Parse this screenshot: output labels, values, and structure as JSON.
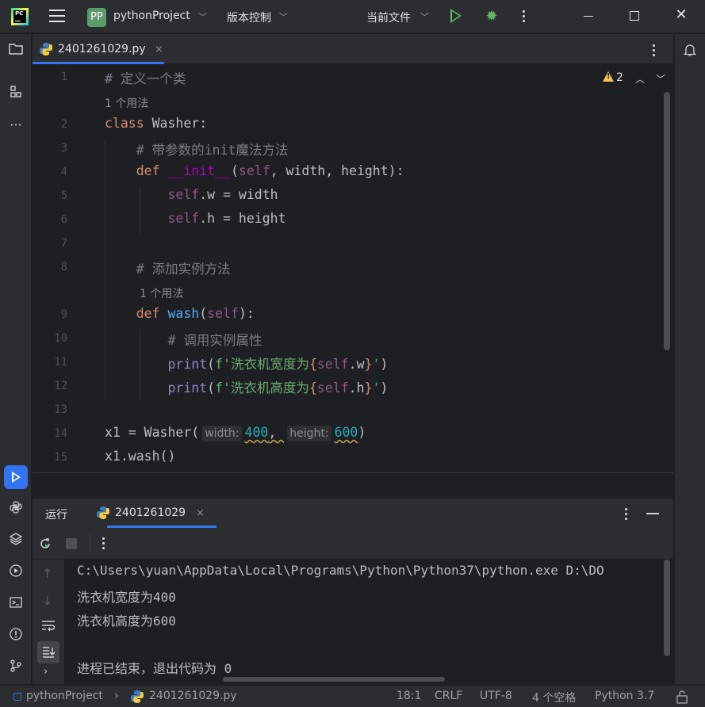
{
  "titlebar": {
    "project_badge": "PP",
    "project_name": "pythonProject",
    "vcs_label": "版本控制",
    "run_config": "当前文件"
  },
  "editor": {
    "tab": {
      "filename": "2401261029.py",
      "close": "×"
    },
    "warnings_count": "2",
    "lines": [
      {
        "num": "1",
        "kind": "code",
        "id": "l1"
      },
      {
        "num": "",
        "kind": "usage",
        "text": "1 个用法"
      },
      {
        "num": "2",
        "kind": "code",
        "id": "l2"
      },
      {
        "num": "3",
        "kind": "code",
        "id": "l3"
      },
      {
        "num": "4",
        "kind": "code",
        "id": "l4"
      },
      {
        "num": "5",
        "kind": "code",
        "id": "l5"
      },
      {
        "num": "6",
        "kind": "code",
        "id": "l6"
      },
      {
        "num": "7",
        "kind": "code",
        "id": "l7"
      },
      {
        "num": "8",
        "kind": "code",
        "id": "l8"
      },
      {
        "num": "",
        "kind": "usage",
        "text": "1 个用法"
      },
      {
        "num": "9",
        "kind": "code",
        "id": "l9"
      },
      {
        "num": "10",
        "kind": "code",
        "id": "l10"
      },
      {
        "num": "11",
        "kind": "code",
        "id": "l11"
      },
      {
        "num": "12",
        "kind": "code",
        "id": "l12"
      },
      {
        "num": "13",
        "kind": "code",
        "id": "l13"
      },
      {
        "num": "14",
        "kind": "code",
        "id": "l14"
      },
      {
        "num": "15",
        "kind": "code",
        "id": "l15"
      }
    ],
    "code": {
      "l1": [
        {
          "t": "cmt",
          "v": "# 定义一个类"
        }
      ],
      "l2": [
        {
          "t": "kw",
          "v": "class "
        },
        {
          "t": "plain",
          "v": "Washer:"
        }
      ],
      "l3": [
        {
          "t": "plain",
          "v": "    "
        },
        {
          "t": "cmt",
          "v": "# 带参数的init魔法方法"
        }
      ],
      "l4": [
        {
          "t": "plain",
          "v": "    "
        },
        {
          "t": "kw",
          "v": "def "
        },
        {
          "t": "magic",
          "v": "__init__"
        },
        {
          "t": "plain",
          "v": "("
        },
        {
          "t": "self",
          "v": "self"
        },
        {
          "t": "plain",
          "v": ", width, height):"
        }
      ],
      "l5": [
        {
          "t": "plain",
          "v": "        "
        },
        {
          "t": "self",
          "v": "self"
        },
        {
          "t": "plain",
          "v": ".w = width"
        }
      ],
      "l6": [
        {
          "t": "plain",
          "v": "        "
        },
        {
          "t": "self",
          "v": "self"
        },
        {
          "t": "plain",
          "v": ".h = height"
        }
      ],
      "l7": [],
      "l8": [
        {
          "t": "plain",
          "v": "    "
        },
        {
          "t": "cmt",
          "v": "# 添加实例方法"
        }
      ],
      "l9": [
        {
          "t": "plain",
          "v": "    "
        },
        {
          "t": "kw",
          "v": "def "
        },
        {
          "t": "fn",
          "v": "wash"
        },
        {
          "t": "plain",
          "v": "("
        },
        {
          "t": "self",
          "v": "self"
        },
        {
          "t": "plain",
          "v": "):"
        }
      ],
      "l10": [
        {
          "t": "plain",
          "v": "        "
        },
        {
          "t": "cmt",
          "v": "# 调用实例属性"
        }
      ],
      "l11": [
        {
          "t": "plain",
          "v": "        "
        },
        {
          "t": "builtin",
          "v": "print"
        },
        {
          "t": "plain",
          "v": "("
        },
        {
          "t": "str",
          "v": "f'洗衣机宽度为"
        },
        {
          "t": "brace",
          "v": "{"
        },
        {
          "t": "self",
          "v": "self"
        },
        {
          "t": "plain",
          "v": ".w"
        },
        {
          "t": "brace",
          "v": "}"
        },
        {
          "t": "str",
          "v": "'"
        },
        {
          "t": "plain",
          "v": ")"
        }
      ],
      "l12": [
        {
          "t": "plain",
          "v": "        "
        },
        {
          "t": "builtin",
          "v": "print"
        },
        {
          "t": "plain",
          "v": "("
        },
        {
          "t": "str",
          "v": "f'洗衣机高度为"
        },
        {
          "t": "brace",
          "v": "{"
        },
        {
          "t": "self",
          "v": "self"
        },
        {
          "t": "plain",
          "v": ".h"
        },
        {
          "t": "brace",
          "v": "}"
        },
        {
          "t": "str",
          "v": "'"
        },
        {
          "t": "plain",
          "v": ")"
        }
      ],
      "l13": [],
      "l14": [
        {
          "t": "plain",
          "v": "x1 = Washer("
        },
        {
          "t": "hint",
          "v": "width:"
        },
        {
          "t": "numsq",
          "v": "400"
        },
        {
          "t": "plainsq",
          "v": ", "
        },
        {
          "t": "hint",
          "v": "height:"
        },
        {
          "t": "numsq",
          "v": "600"
        },
        {
          "t": "plain",
          "v": ")"
        }
      ],
      "l15": [
        {
          "t": "plain",
          "v": "x1.wash()"
        }
      ]
    }
  },
  "run_panel": {
    "title": "运行",
    "tab_label": "2401261029",
    "tab_close": "×",
    "console_lines": [
      "C:\\Users\\yuan\\AppData\\Local\\Programs\\Python\\Python37\\python.exe D:\\DO",
      "洗衣机宽度为400",
      "洗衣机高度为600",
      "",
      "进程已结束，退出代码为 0"
    ]
  },
  "statusbar": {
    "project": "pythonProject",
    "file": "2401261029.py",
    "position": "18:1",
    "line_sep": "CRLF",
    "encoding": "UTF-8",
    "indent": "4 个空格",
    "interpreter": "Python 3.7"
  },
  "colors": {
    "accent": "#3574f0",
    "run_green": "#5fb865",
    "warning": "#f2c55c"
  }
}
